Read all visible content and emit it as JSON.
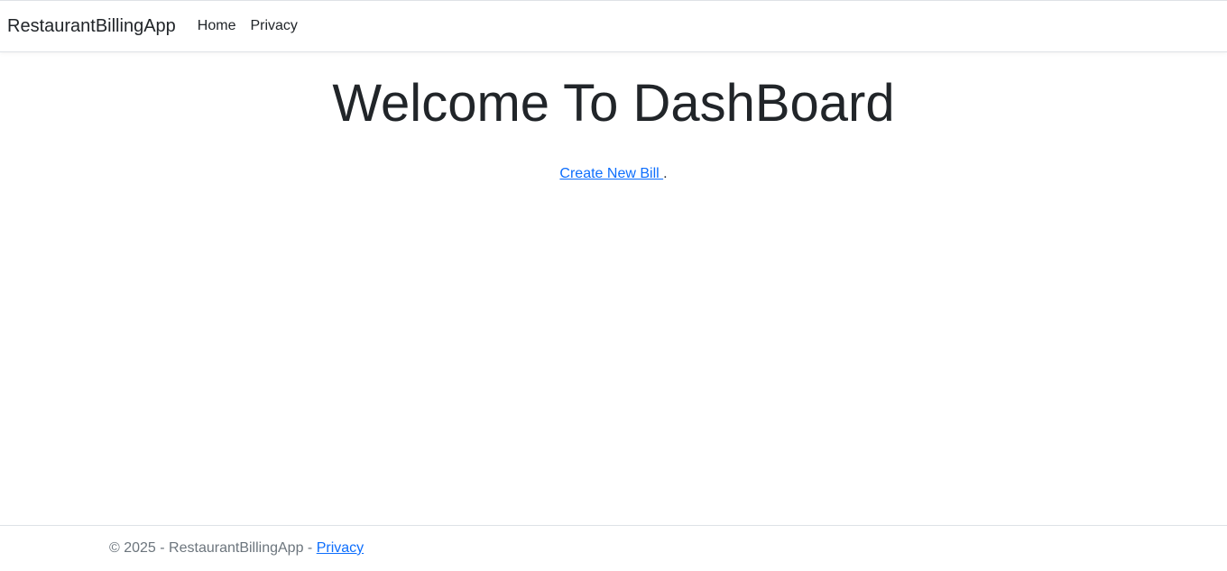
{
  "navbar": {
    "brand": "RestaurantBillingApp",
    "links": [
      "Home",
      "Privacy"
    ]
  },
  "main": {
    "title": "Welcome To DashBoard",
    "create_bill_link": "Create New Bill ",
    "trailing_period": "."
  },
  "footer": {
    "copyright": "© 2025 - RestaurantBillingApp - ",
    "privacy_link": "Privacy"
  },
  "colors": {
    "link": "#0d6efd",
    "text": "#212529",
    "muted": "#6c757d",
    "border": "#dee2e6"
  }
}
